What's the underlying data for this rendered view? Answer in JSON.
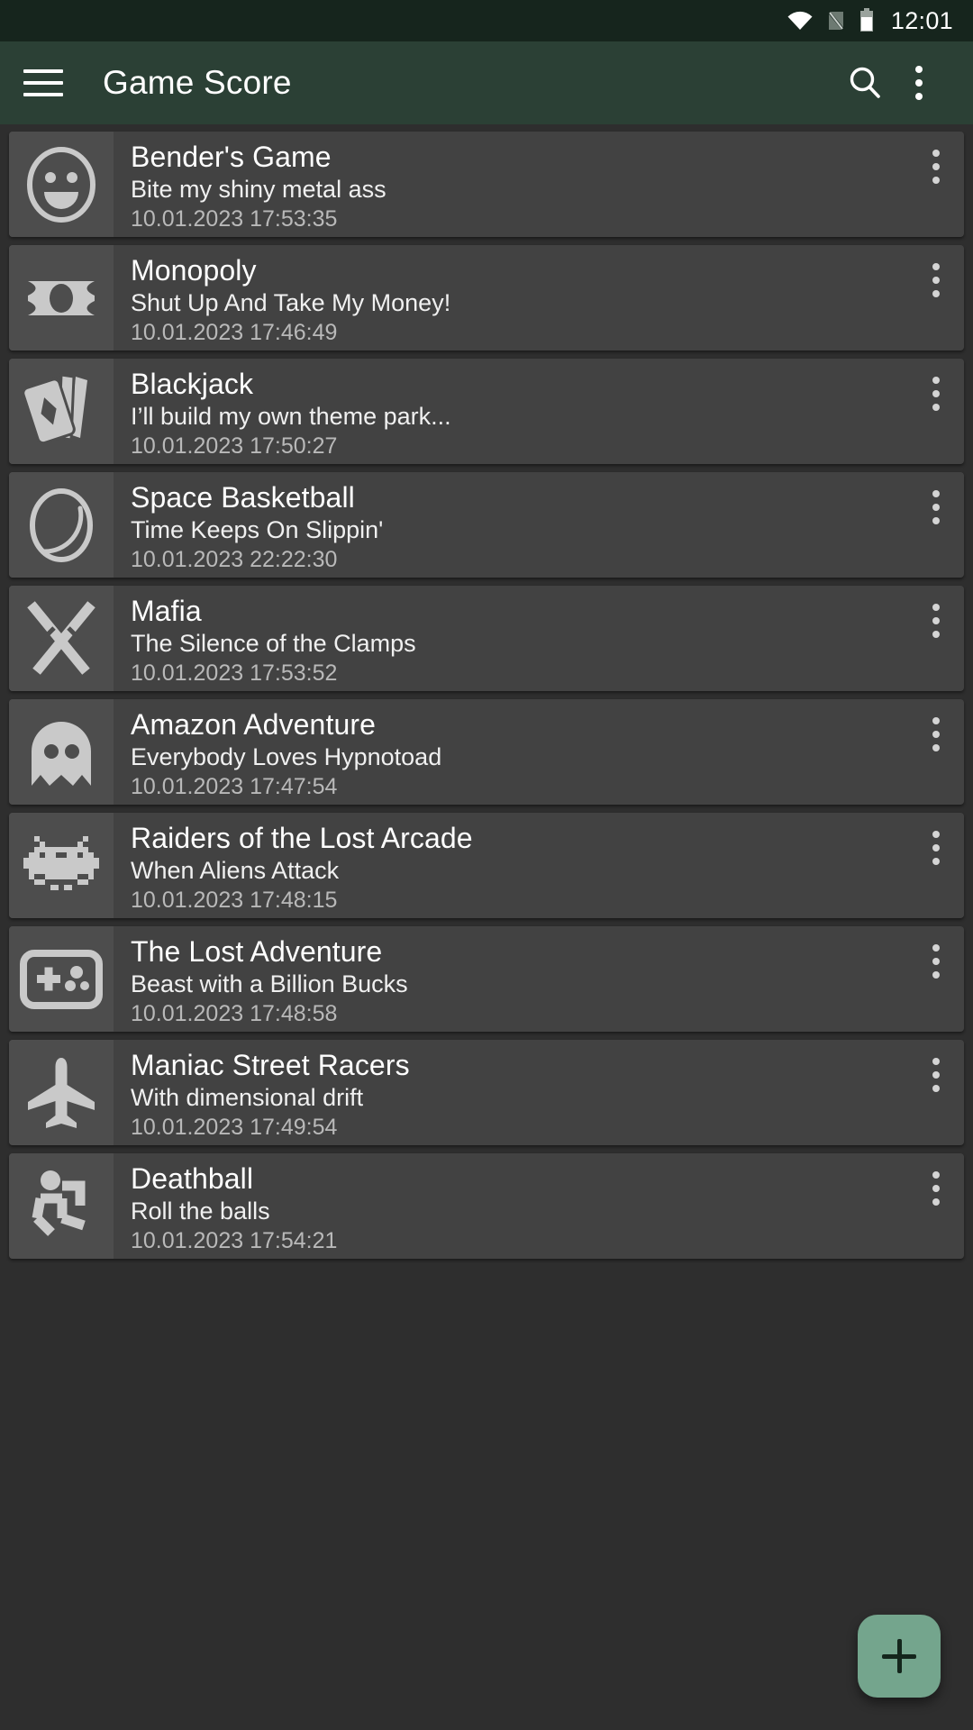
{
  "status_bar": {
    "time": "12:01",
    "icons": [
      "wifi-icon",
      "no-sim-icon",
      "battery-icon"
    ]
  },
  "app_bar": {
    "menu_icon": "hamburger-menu-icon",
    "title": "Game Score",
    "search_icon": "search-icon",
    "overflow_icon": "more-vert-icon"
  },
  "colors": {
    "status_bar_bg": "#16251d",
    "app_bar_bg": "#2b4035",
    "page_bg": "#2e2e2e",
    "card_bg": "#424242",
    "card_icon_bg": "#4d4d4d",
    "fab_bg": "#74a58d",
    "title_text": "#ffffff",
    "subtitle_text": "#f0f0f0",
    "date_text": "#b9b9b9"
  },
  "list": {
    "items": [
      {
        "icon": "smiley-face-icon",
        "title": "Bender's Game",
        "subtitle": "Bite my shiny metal ass",
        "date": "10.01.2023 17:53:35",
        "menu_icon": "more-vert-icon"
      },
      {
        "icon": "banknote-icon",
        "title": "Monopoly",
        "subtitle": "Shut Up And Take My Money!",
        "date": "10.01.2023 17:46:49",
        "menu_icon": "more-vert-icon"
      },
      {
        "icon": "playing-cards-icon",
        "title": "Blackjack",
        "subtitle": "I’ll build my own theme park...",
        "date": "10.01.2023 17:50:27",
        "menu_icon": "more-vert-icon"
      },
      {
        "icon": "ball-circle-icon",
        "title": "Space Basketball",
        "subtitle": "Time Keeps On Slippin'",
        "date": "10.01.2023 22:22:30",
        "menu_icon": "more-vert-icon"
      },
      {
        "icon": "crossed-swords-icon",
        "title": "Mafia",
        "subtitle": "The Silence of the Clamps",
        "date": "10.01.2023 17:53:52",
        "menu_icon": "more-vert-icon"
      },
      {
        "icon": "ghost-icon",
        "title": "Amazon Adventure",
        "subtitle": "Everybody Loves Hypnotoad",
        "date": "10.01.2023 17:47:54",
        "menu_icon": "more-vert-icon"
      },
      {
        "icon": "space-invader-icon",
        "title": "Raiders of the Lost Arcade",
        "subtitle": "When Aliens Attack",
        "date": "10.01.2023 17:48:15",
        "menu_icon": "more-vert-icon"
      },
      {
        "icon": "gamepad-icon",
        "title": "The Lost Adventure",
        "subtitle": "Beast with a Billion Bucks",
        "date": "10.01.2023 17:48:58",
        "menu_icon": "more-vert-icon"
      },
      {
        "icon": "airplane-icon",
        "title": "Maniac Street Racers",
        "subtitle": "With dimensional drift",
        "date": "10.01.2023 17:49:54",
        "menu_icon": "more-vert-icon"
      },
      {
        "icon": "running-person-icon",
        "title": "Deathball",
        "subtitle": "Roll the balls",
        "date": "10.01.2023 17:54:21",
        "menu_icon": "more-vert-icon"
      }
    ]
  },
  "fab": {
    "icon": "plus-icon",
    "label": "+"
  }
}
